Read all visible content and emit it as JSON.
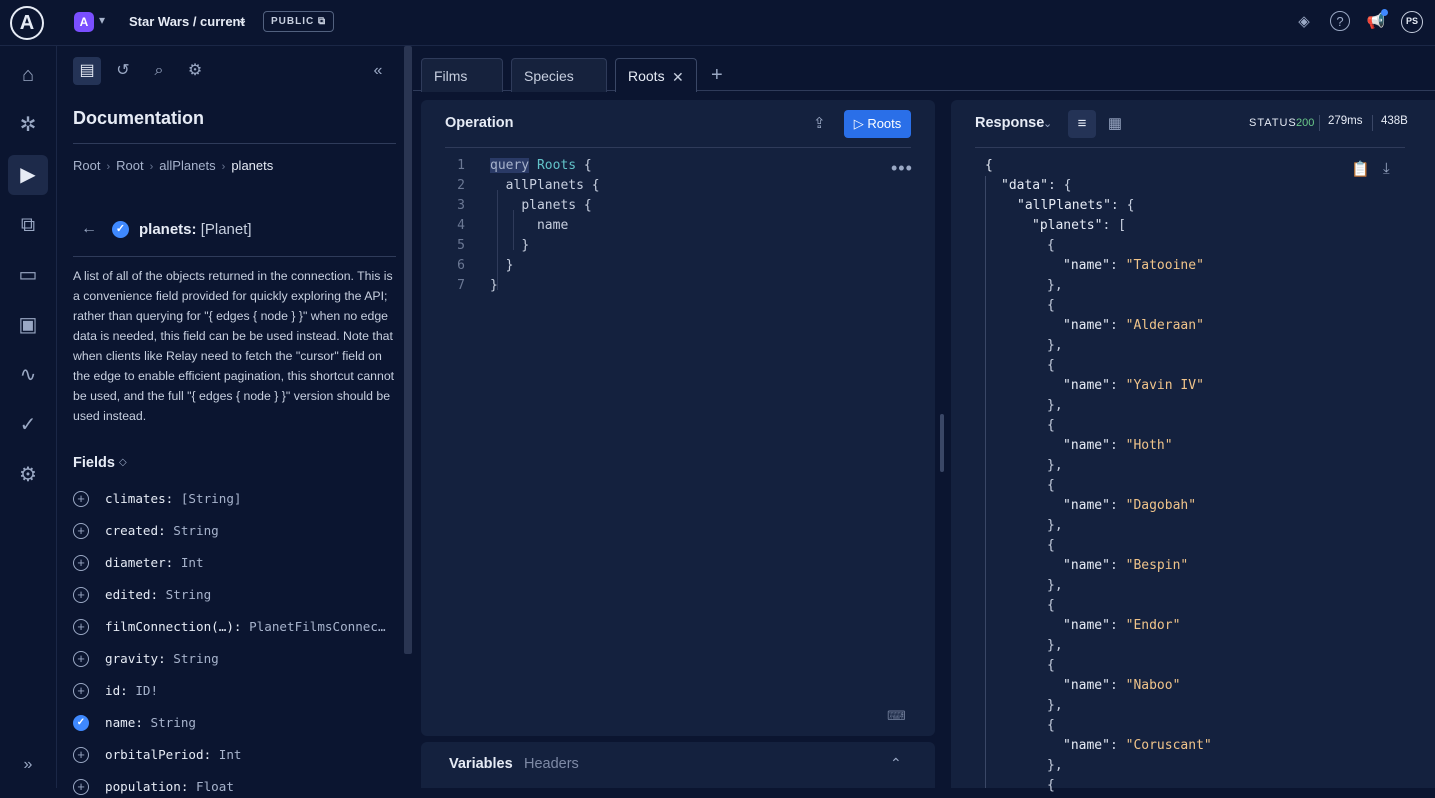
{
  "topbar": {
    "logo": "A",
    "graph_avatar": "A",
    "graph_name": "Star Wars / current",
    "visibility_badge": "PUBLIC",
    "user_initials": "PS",
    "icons": [
      "layers-icon",
      "help-icon",
      "announcements-icon"
    ]
  },
  "leftnav": {
    "items": [
      "home-icon",
      "schema-icon",
      "explorer-icon",
      "checks-icon",
      "variants-icon",
      "clients-icon",
      "insights-icon",
      "launches-icon",
      "settings-icon"
    ],
    "active": "explorer-icon",
    "expand": "»"
  },
  "docs": {
    "title": "Documentation",
    "breadcrumb": [
      "Root",
      "Root",
      "allPlanets",
      "planets"
    ],
    "field_name": "planets:",
    "field_type": "[Planet]",
    "description": "A list of all of the objects returned in the connection. This is a convenience field provided for quickly exploring the API; rather than querying for \"{ edges { node } }\" when no edge data is needed, this field can be be used instead. Note that when clients like Relay need to fetch the \"cursor\" field on the edge to enable efficient pagination, this shortcut cannot be used, and the full \"{ edges { node } }\" version should be used instead.",
    "fields_heading": "Fields",
    "fields": [
      {
        "name": "climates:",
        "type": "[String]",
        "selected": false
      },
      {
        "name": "created:",
        "type": "String",
        "selected": false
      },
      {
        "name": "diameter:",
        "type": "Int",
        "selected": false
      },
      {
        "name": "edited:",
        "type": "String",
        "selected": false
      },
      {
        "name": "filmConnection(…):",
        "type": "PlanetFilmsConnec…",
        "selected": false
      },
      {
        "name": "gravity:",
        "type": "String",
        "selected": false
      },
      {
        "name": "id:",
        "type": "ID!",
        "selected": false
      },
      {
        "name": "name:",
        "type": "String",
        "selected": true
      },
      {
        "name": "orbitalPeriod:",
        "type": "Int",
        "selected": false
      },
      {
        "name": "population:",
        "type": "Float",
        "selected": false
      }
    ]
  },
  "tabs": [
    {
      "label": "Films",
      "active": false
    },
    {
      "label": "Species",
      "active": false
    },
    {
      "label": "Roots",
      "active": true
    }
  ],
  "operation": {
    "title": "Operation",
    "run_label": "▷ Roots",
    "lines": [
      {
        "n": "1",
        "indent": "",
        "keyword": "query",
        "name": "Roots",
        "rest": " {"
      },
      {
        "n": "2",
        "indent": "  ",
        "keyword": "",
        "name": "",
        "rest": "allPlanets {"
      },
      {
        "n": "3",
        "indent": "    ",
        "keyword": "",
        "name": "",
        "rest": "planets {"
      },
      {
        "n": "4",
        "indent": "      ",
        "keyword": "",
        "name": "",
        "rest": "name"
      },
      {
        "n": "5",
        "indent": "    ",
        "keyword": "",
        "name": "",
        "rest": "}"
      },
      {
        "n": "6",
        "indent": "  ",
        "keyword": "",
        "name": "",
        "rest": "}"
      },
      {
        "n": "7",
        "indent": "",
        "keyword": "",
        "name": "",
        "rest": "}"
      }
    ]
  },
  "variables": {
    "variables_label": "Variables",
    "headers_label": "Headers"
  },
  "response": {
    "title": "Response",
    "status_label": "STATUS",
    "status_code": "200",
    "time": "279ms",
    "size": "438B",
    "planets": [
      "Tatooine",
      "Alderaan",
      "Yavin IV",
      "Hoth",
      "Dagobah",
      "Bespin",
      "Endor",
      "Naboo",
      "Coruscant"
    ]
  },
  "colors": {
    "background": "#0b1530",
    "panel": "#14213e",
    "accent": "#2a6fe8",
    "status_ok": "#6bc98a",
    "json_string": "#f0c48a"
  }
}
